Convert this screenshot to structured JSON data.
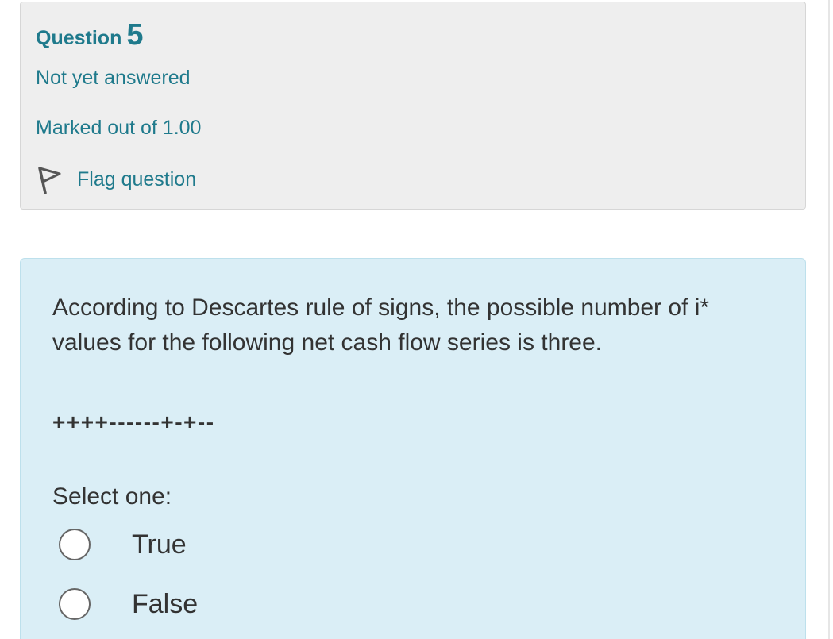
{
  "question": {
    "word": "Question",
    "number": "5",
    "state": "Not yet answered",
    "grade": "Marked out of 1.00",
    "flag_label": "Flag question",
    "flag_icon": "flag-outline-icon"
  },
  "content": {
    "text": "According to Descartes rule of signs, the possible number of i* values for the following net cash flow series is three.",
    "signs": "++++------+-+--",
    "prompt": "Select one:",
    "options": [
      {
        "label": "True",
        "selected": false
      },
      {
        "label": "False",
        "selected": false
      }
    ]
  },
  "colors": {
    "accent": "#1f7a8c",
    "info_bg": "#eeeeee",
    "content_bg": "#daeef6",
    "text": "#333333"
  }
}
